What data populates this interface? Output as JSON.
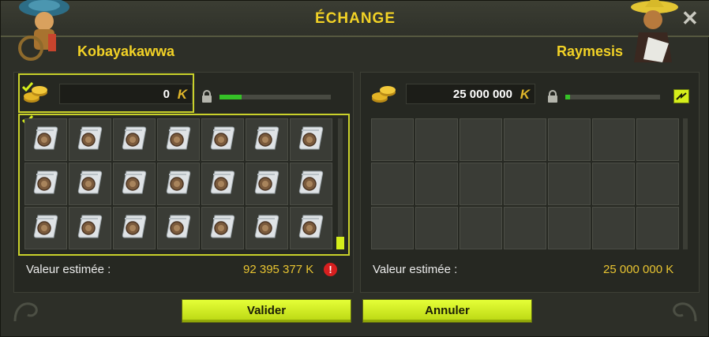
{
  "window": {
    "title": "ÉCHANGE"
  },
  "left": {
    "player_name": "Kobayakawwa",
    "kamas": "0",
    "currency_symbol": "K",
    "slider_fill": 0.2,
    "value_label": "Valeur estimée :",
    "value_amount": "92 395 377 K",
    "items": [
      "scroll",
      "scroll",
      "scroll",
      "scroll",
      "scroll",
      "scroll",
      "scroll",
      "scroll",
      "scroll",
      "scroll",
      "scroll",
      "scroll",
      "scroll",
      "scroll",
      "scroll",
      "scroll",
      "scroll",
      "scroll",
      "scroll",
      "scroll",
      "scroll"
    ]
  },
  "right": {
    "player_name": "Raymesis",
    "kamas": "25 000 000",
    "currency_symbol": "K",
    "slider_fill": 0.05,
    "value_label": "Valeur estimée :",
    "value_amount": "25 000 000 K"
  },
  "buttons": {
    "validate": "Valider",
    "cancel": "Annuler"
  },
  "colors": {
    "accent": "#d5ee1b",
    "title": "#f2d226",
    "warning": "#d71f1f",
    "slider": "#35c227"
  },
  "icons": [
    "close-icon",
    "coins-icon",
    "lock-icon",
    "kama-icon",
    "check-icon",
    "warning-icon",
    "scroll-item-icon",
    "toggle-icon"
  ]
}
